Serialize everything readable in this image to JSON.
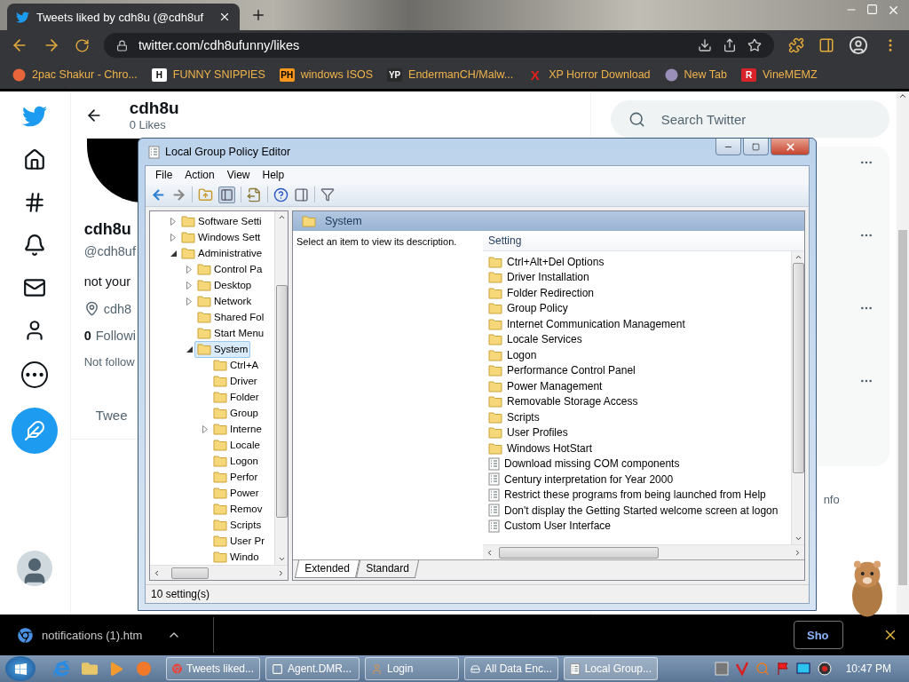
{
  "browser": {
    "tab": {
      "title": "Tweets liked by cdh8u (@cdh8uf",
      "selected": true
    },
    "address": "twitter.com/cdh8ufunny/likes",
    "bookmarks": [
      {
        "label": "2pac Shakur - Chro...",
        "kind": "picture",
        "color": "#e8643a"
      },
      {
        "label": "FUNNY SNIPPIES",
        "kind": "badge",
        "badge": "H",
        "color": "#ffffff"
      },
      {
        "label": "windows ISOS",
        "kind": "badge",
        "badge": "PH",
        "color": "#f7971d"
      },
      {
        "label": "EndermanCH/Malw...",
        "kind": "badge",
        "badge": "YP",
        "color": "#2a2a2a"
      },
      {
        "label": "XP Horror Download",
        "kind": "letter",
        "badge": "X",
        "color": "#e0201b"
      },
      {
        "label": "New Tab",
        "kind": "picture",
        "color": "#9a8fb8"
      },
      {
        "label": "VineMEMZ",
        "kind": "badge",
        "badge": "R",
        "color": "#d8232a"
      }
    ]
  },
  "twitter": {
    "header": {
      "name": "cdh8u",
      "count": "0 Likes"
    },
    "profile": {
      "name": "cdh8u",
      "handle": "@cdh8uf",
      "bio": "not your",
      "location": "cdh8",
      "following_count": "0",
      "following_label": "Followi",
      "note": "Not follow"
    },
    "tabs": [
      {
        "label": "Twee",
        "selected": false
      }
    ],
    "search": {
      "placeholder": "Search Twitter"
    },
    "side_text": "nfo"
  },
  "policy_editor": {
    "title": "Local Group Policy Editor",
    "menu": [
      "File",
      "Action",
      "View",
      "Help"
    ],
    "tree": [
      {
        "label": "Software Setti",
        "kind": "node",
        "expanded": false,
        "selected": false
      },
      {
        "label": "Windows Sett",
        "kind": "node",
        "expanded": false,
        "selected": false
      },
      {
        "label": "Administrative",
        "kind": "node",
        "expanded": true,
        "selected": false,
        "children": [
          {
            "label": "Control Pa",
            "kind": "node",
            "expanded": false,
            "selected": false
          },
          {
            "label": "Desktop",
            "kind": "node",
            "expanded": false,
            "selected": false
          },
          {
            "label": "Network",
            "kind": "node",
            "expanded": false,
            "selected": false
          },
          {
            "label": "Shared Fol",
            "kind": "leaf",
            "selected": false
          },
          {
            "label": "Start Menu",
            "kind": "leaf",
            "selected": false
          },
          {
            "label": "System",
            "kind": "node",
            "expanded": true,
            "selected": true,
            "children": [
              {
                "label": "Ctrl+A",
                "kind": "leaf",
                "selected": false
              },
              {
                "label": "Driver",
                "kind": "leaf",
                "selected": false
              },
              {
                "label": "Folder",
                "kind": "leaf",
                "selected": false
              },
              {
                "label": "Group",
                "kind": "leaf",
                "selected": false
              },
              {
                "label": "Interne",
                "kind": "node",
                "expanded": false,
                "selected": false
              },
              {
                "label": "Locale",
                "kind": "leaf",
                "selected": false
              },
              {
                "label": "Logon",
                "kind": "leaf",
                "selected": false
              },
              {
                "label": "Perfor",
                "kind": "leaf",
                "selected": false
              },
              {
                "label": "Power",
                "kind": "leaf",
                "selected": false
              },
              {
                "label": "Remov",
                "kind": "leaf",
                "selected": false
              },
              {
                "label": "Scripts",
                "kind": "leaf",
                "selected": false
              },
              {
                "label": "User Pr",
                "kind": "leaf",
                "selected": false
              },
              {
                "label": "Windo",
                "kind": "leaf",
                "selected": false
              }
            ]
          }
        ]
      }
    ],
    "panel_title": "System",
    "description": "Select an item to view its description.",
    "column": "Setting",
    "rows": [
      {
        "label": "Ctrl+Alt+Del Options",
        "kind": "folder"
      },
      {
        "label": "Driver Installation",
        "kind": "folder"
      },
      {
        "label": "Folder Redirection",
        "kind": "folder"
      },
      {
        "label": "Group Policy",
        "kind": "folder"
      },
      {
        "label": "Internet Communication Management",
        "kind": "folder"
      },
      {
        "label": "Locale Services",
        "kind": "folder"
      },
      {
        "label": "Logon",
        "kind": "folder"
      },
      {
        "label": "Performance Control Panel",
        "kind": "folder"
      },
      {
        "label": "Power Management",
        "kind": "folder"
      },
      {
        "label": "Removable Storage Access",
        "kind": "folder"
      },
      {
        "label": "Scripts",
        "kind": "folder"
      },
      {
        "label": "User Profiles",
        "kind": "folder"
      },
      {
        "label": "Windows HotStart",
        "kind": "folder"
      },
      {
        "label": "Download missing COM components",
        "kind": "setting"
      },
      {
        "label": "Century interpretation for Year 2000",
        "kind": "setting"
      },
      {
        "label": "Restrict these programs from being launched from Help",
        "kind": "setting"
      },
      {
        "label": "Don't display the Getting Started welcome screen at logon",
        "kind": "setting"
      },
      {
        "label": "Custom User Interface",
        "kind": "setting"
      }
    ],
    "tabs": [
      {
        "label": "Extended",
        "selected": true
      },
      {
        "label": "Standard",
        "selected": false
      }
    ],
    "status": "10 setting(s)"
  },
  "downloads": {
    "file": "notifications (1).htm",
    "button": "Sho"
  },
  "taskbar": {
    "tasks": [
      {
        "label": "Tweets liked...",
        "kind": "browser",
        "selected": false
      },
      {
        "label": "Agent.DMR...",
        "kind": "window",
        "selected": false
      },
      {
        "label": "Login",
        "kind": "user",
        "selected": false
      },
      {
        "label": "All Data Enc...",
        "kind": "disk",
        "selected": false
      },
      {
        "label": "Local Group...",
        "kind": "scroll",
        "selected": true
      }
    ],
    "clock": "10:47 PM"
  }
}
